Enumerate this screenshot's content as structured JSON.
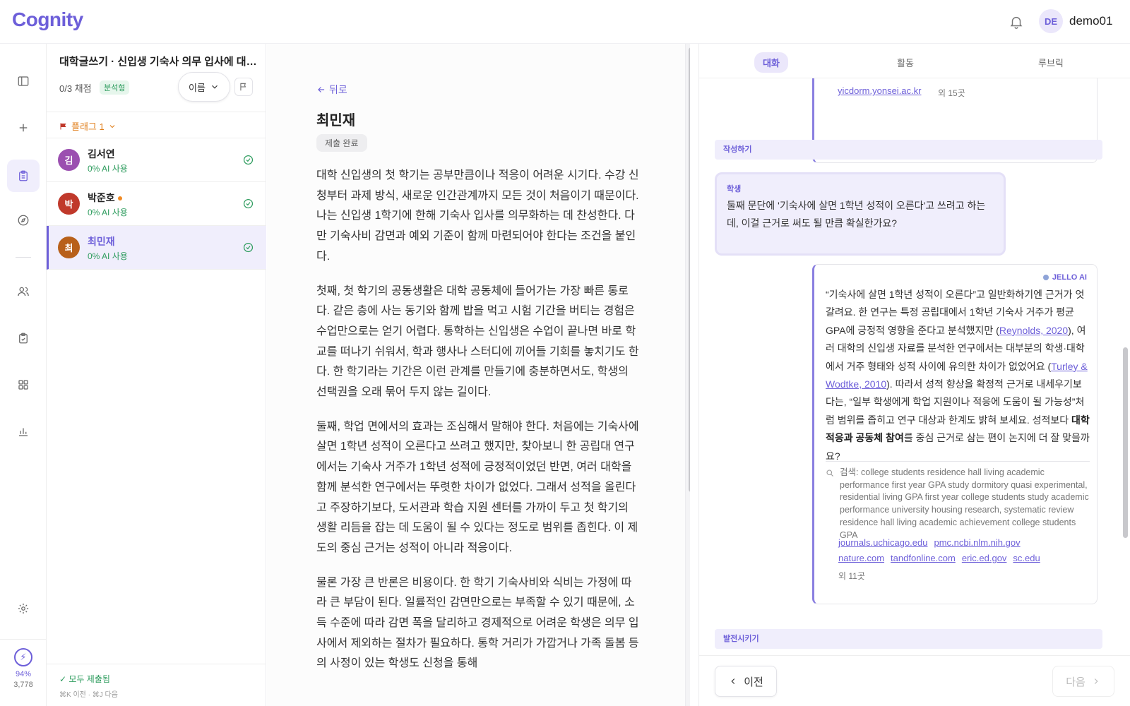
{
  "app": {
    "logo": "Cognity",
    "user_initials": "DE",
    "username": "demo01"
  },
  "rail": {
    "energy_pct": "94%",
    "energy_count": "3,778"
  },
  "assignment": {
    "title": "대학글쓰기 · 신입생 기숙사 의무 입사에 대한 찬반 논설문",
    "grade_count": "0/3 채점",
    "type_badge": "분석형",
    "sort_label": "이름",
    "flag_filter": "플래그 1"
  },
  "students": [
    {
      "initial": "김",
      "name": "김서연",
      "ai": "0% AI 사용",
      "color": "#9b4fb0"
    },
    {
      "initial": "박",
      "name": "박준호",
      "ai": "0% AI 사용",
      "color": "#c0392b"
    },
    {
      "initial": "최",
      "name": "최민재",
      "ai": "0% AI 사용",
      "color": "#b8601a"
    }
  ],
  "list_footer": {
    "status": "✓ 모두 제출됨",
    "shortcut": "⌘K 이전 · ⌘J 다음"
  },
  "doc": {
    "back": "뒤로",
    "student_name": "최민재",
    "status": "제출 완료",
    "paragraphs": [
      "대학 신입생의 첫 학기는 공부만큼이나 적응이 어려운 시기다. 수강 신청부터 과제 방식, 새로운 인간관계까지 모든 것이 처음이기 때문이다. 나는 신입생 1학기에 한해 기숙사 입사를 의무화하는 데 찬성한다. 다만 기숙사비 감면과 예외 기준이 함께 마련되어야 한다는 조건을 붙인다.",
      "첫째, 첫 학기의 공동생활은 대학 공동체에 들어가는 가장 빠른 통로다. 같은 층에 사는 동기와 함께 밥을 먹고 시험 기간을 버티는 경험은 수업만으로는 얻기 어렵다. 통학하는 신입생은 수업이 끝나면 바로 학교를 떠나기 쉬워서, 학과 행사나 스터디에 끼어들 기회를 놓치기도 한다. 한 학기라는 기간은 이런 관계를 만들기에 충분하면서도, 학생의 선택권을 오래 묶어 두지 않는 길이다.",
      "둘째, 학업 면에서의 효과는 조심해서 말해야 한다. 처음에는 기숙사에 살면 1학년 성적이 오른다고 쓰려고 했지만, 찾아보니 한 공립대 연구에서는 기숙사 거주가 1학년 성적에 긍정적이었던 반면, 여러 대학을 함께 분석한 연구에서는 뚜렷한 차이가 없었다. 그래서 성적을 올린다고 주장하기보다, 도서관과 학습 지원 센터를 가까이 두고 첫 학기의 생활 리듬을 잡는 데 도움이 될 수 있다는 정도로 범위를 좁힌다. 이 제도의 중심 근거는 성적이 아니라 적응이다.",
      "물론 가장 큰 반론은 비용이다. 한 학기 기숙사비와 식비는 가정에 따라 큰 부담이 된다. 일률적인 감면만으로는 부족할 수 있기 때문에, 소득 수준에 따라 감면 폭을 달리하고 경제적으로 어려운 학생은 의무 입사에서 제외하는 절차가 필요하다. 통학 거리가 가깝거나 가족 돌봄 등의 사정이 있는 학생도 신청을 통해"
    ]
  },
  "chat": {
    "tabs": [
      "대화",
      "활동",
      "루브릭"
    ],
    "top_link": "yicdorm.yonsei.ac.kr",
    "top_more": "외 15곳",
    "section_write": "작성하기",
    "student_label": "학생",
    "student_msg": "둘째 문단에 '기숙사에 살면 1학년 성적이 오른다'고 쓰려고 하는데, 이걸 근거로 써도 될 만큼 확실한가요?",
    "ai_label": "JELLO AI",
    "ai_msg": {
      "p1": "“기숙사에 살면 1학년 성적이 오른다”고 일반화하기엔 근거가 엇갈려요. 한 연구는 특정 공립대에서 1학년 기숙사 거주가 평균 GPA에 긍정적 영향을 준다고 분석했지만 (",
      "cite1": "Reynolds, 2020",
      "p2": "), 여러 대학의 신입생 자료를 분석한 연구에서는 대부분의 학생·대학에서 거주 형태와 성적 사이에 유의한 차이가 없었어요 (",
      "cite2": "Turley & Wodtke, 2010",
      "p3": "). 따라서 성적 향상을 확정적 근거로 내세우기보다는, “일부 학생에게 학업 지원이나 적응에 도움이 될 가능성”처럼 범위를 좁히고 연구 대상과 한계도 밝혀 보세요. 성적보다 ",
      "bold": "대학 적응과 공동체 참여",
      "p4": "를 중심 근거로 삼는 편이 논지에 더 잘 맞을까요?"
    },
    "search": "검색: college students residence hall living academic performance first year GPA study dormitory quasi experimental, residential living GPA first year college students study academic performance university housing research, systematic review residence hall living academic achievement college students GPA",
    "links": [
      "journals.uchicago.edu",
      "pmc.ncbi.nlm.nih.gov",
      "nature.com",
      "tandfonline.com",
      "eric.ed.gov",
      "sc.edu"
    ],
    "links_more": "외 11곳",
    "section_develop": "발전시키기",
    "prev": "이전",
    "next": "다음"
  }
}
